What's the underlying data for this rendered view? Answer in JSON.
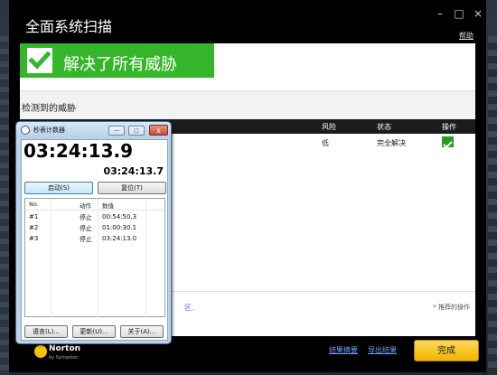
{
  "norton": {
    "title": "全面系统扫描",
    "help": "帮助",
    "controls": [
      "–",
      "□",
      "×"
    ],
    "banner": {
      "text": "解决了所有威胁",
      "icon": "checkmark-icon"
    },
    "section_title": "检测到的威胁",
    "columns": {
      "risk": "风险",
      "status": "状态",
      "action": "操作"
    },
    "row": {
      "risk": "低",
      "status": "完全解决",
      "action_icon": "check-icon"
    },
    "footer_note": "* 推荐的操作",
    "footer_dot": "区.",
    "links": {
      "summary": "结果摘要",
      "export": "导出结果"
    },
    "done": "完成",
    "logo": {
      "name": "Norton",
      "by": "by Symantec"
    }
  },
  "stopwatch": {
    "title": "秒表计数器",
    "main_time": "03:24:13.9",
    "lap_time": "03:24:13.7",
    "buttons": {
      "start": "启动(S)",
      "reset": "复位(T)"
    },
    "list_headers": {
      "no": "No.",
      "action": "动作",
      "value": "数值"
    },
    "laps": [
      {
        "no": "#1",
        "action": "停止",
        "value": "00:54:50.3"
      },
      {
        "no": "#2",
        "action": "停止",
        "value": "01:00:30.1"
      },
      {
        "no": "#3",
        "action": "停止",
        "value": "03:24:13.0"
      }
    ],
    "bottom_buttons": {
      "language": "语言(L)...",
      "update": "更新(U)...",
      "about": "关于(A)..."
    },
    "colors": {
      "frame": "#bcd3ea",
      "green": "#35b62a",
      "accent": "#f1b500"
    }
  }
}
